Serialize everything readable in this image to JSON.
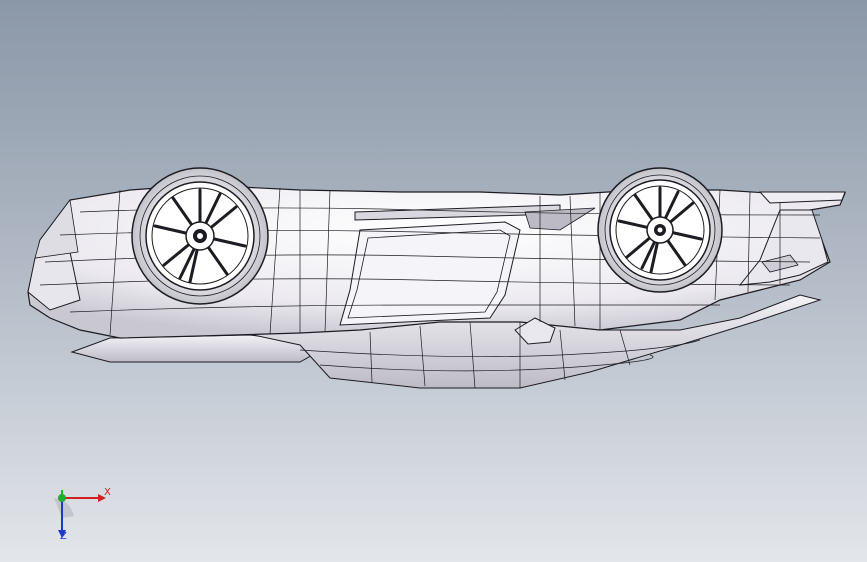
{
  "viewport": {
    "background_top": "#8b98a8",
    "background_bottom": "#e3e6ea"
  },
  "model": {
    "description_icon": "wireframe-car-body-icon",
    "wheel_icon": "wheel-rim-icon",
    "body_fill": "#f1f1f4",
    "line_color": "#1c1c22"
  },
  "triad": {
    "x_label": "X",
    "z_label": "Z",
    "x_color": "#d21f1f",
    "y_color": "#1fae2e",
    "z_color": "#2039c8"
  }
}
